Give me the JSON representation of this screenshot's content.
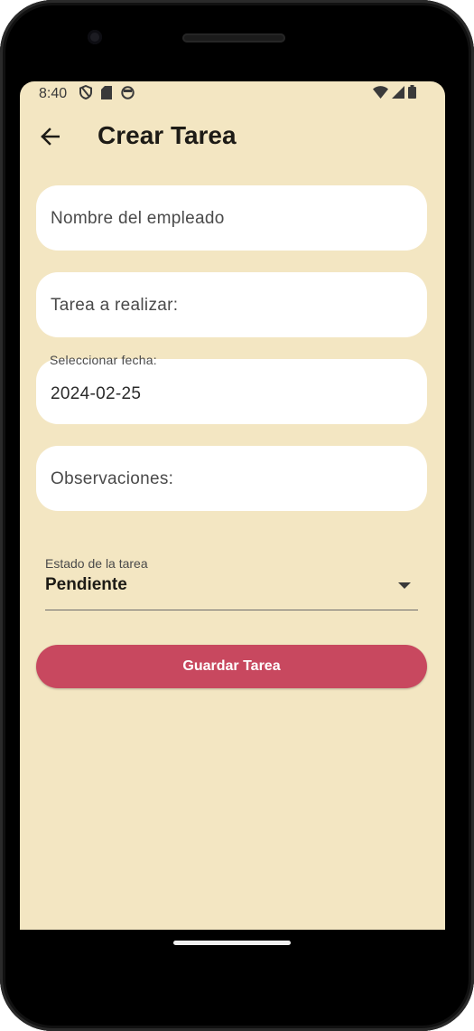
{
  "status_bar": {
    "time": "8:40",
    "left_icons": [
      "shield-icon",
      "sd-card-icon",
      "face-icon"
    ],
    "right_icons": [
      "wifi-icon",
      "signal-icon",
      "battery-icon"
    ]
  },
  "app_bar": {
    "title": "Crear Tarea",
    "back_icon": "arrow-back-icon"
  },
  "form": {
    "employee_name": {
      "placeholder": "Nombre del empleado",
      "value": ""
    },
    "task": {
      "placeholder": "Tarea a realizar:",
      "value": ""
    },
    "date": {
      "label": "Seleccionar fecha:",
      "value": "2024-02-25"
    },
    "observations": {
      "placeholder": "Observaciones:",
      "value": ""
    },
    "status": {
      "label": "Estado de la tarea",
      "selected": "Pendiente"
    },
    "save_button": "Guardar Tarea"
  },
  "colors": {
    "background": "#f3e6c2",
    "accent": "#c8485f",
    "field": "#ffffff"
  }
}
